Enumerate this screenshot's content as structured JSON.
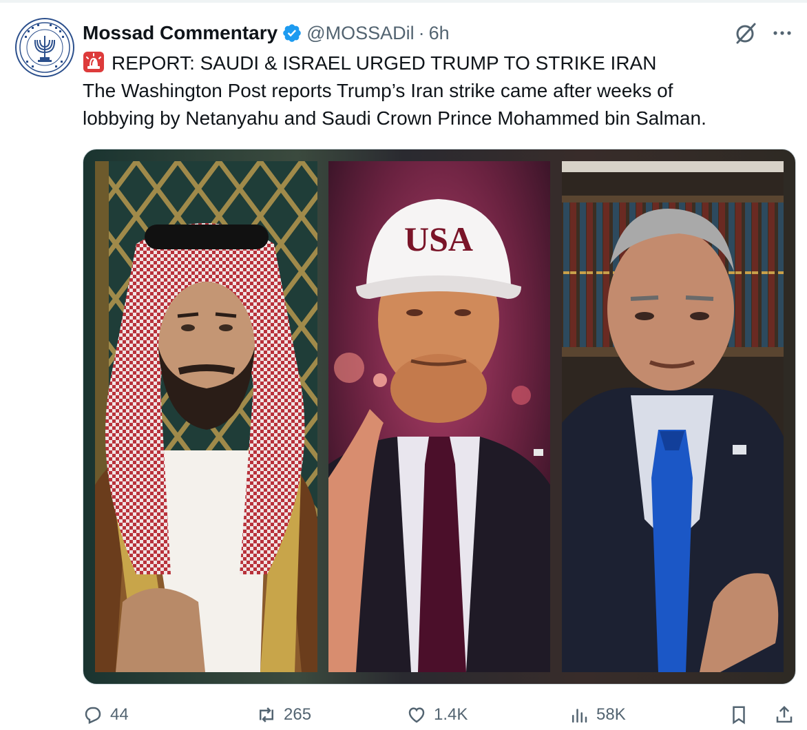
{
  "tweet": {
    "display_name": "Mossad Commentary",
    "handle": "@MOSSADil",
    "separator": "·",
    "time": "6h",
    "headline": "REPORT: SAUDI & ISRAEL URGED TRUMP TO STRIKE IRAN",
    "body_line_1": "The Washington Post reports Trump’s Iran strike came after weeks of",
    "body_line_2": "lobbying by Netanyahu and Saudi Crown Prince Mohammed bin Salman.",
    "headline_icon": "rotating-light-icon",
    "verified_badge": "verified-icon",
    "accent_color": "#1d9bf0"
  },
  "media": {
    "panels": [
      "saudi-crown-prince-photo",
      "trump-photo",
      "netanyahu-photo"
    ],
    "cap_text": "USA"
  },
  "actions": {
    "replies": "44",
    "reposts": "265",
    "likes": "1.4K",
    "views": "58K",
    "icons": [
      "reply-icon",
      "repost-icon",
      "like-icon",
      "views-icon",
      "bookmark-icon",
      "share-icon"
    ]
  }
}
